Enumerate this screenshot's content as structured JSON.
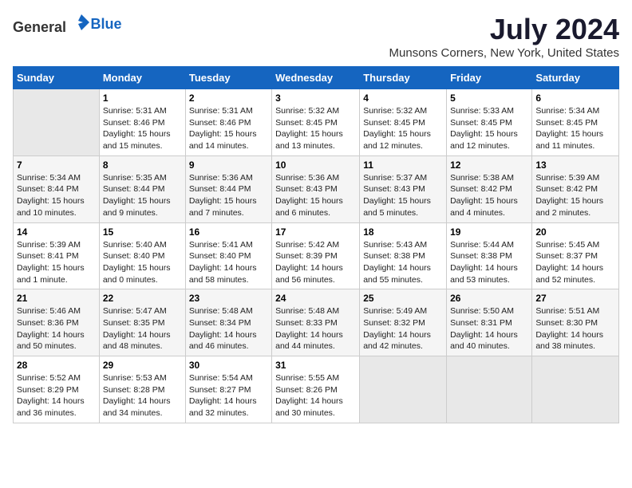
{
  "header": {
    "logo_general": "General",
    "logo_blue": "Blue",
    "title": "July 2024",
    "subtitle": "Munsons Corners, New York, United States"
  },
  "calendar": {
    "days_of_week": [
      "Sunday",
      "Monday",
      "Tuesday",
      "Wednesday",
      "Thursday",
      "Friday",
      "Saturday"
    ],
    "weeks": [
      [
        {
          "day": "",
          "info": ""
        },
        {
          "day": "1",
          "info": "Sunrise: 5:31 AM\nSunset: 8:46 PM\nDaylight: 15 hours\nand 15 minutes."
        },
        {
          "day": "2",
          "info": "Sunrise: 5:31 AM\nSunset: 8:46 PM\nDaylight: 15 hours\nand 14 minutes."
        },
        {
          "day": "3",
          "info": "Sunrise: 5:32 AM\nSunset: 8:45 PM\nDaylight: 15 hours\nand 13 minutes."
        },
        {
          "day": "4",
          "info": "Sunrise: 5:32 AM\nSunset: 8:45 PM\nDaylight: 15 hours\nand 12 minutes."
        },
        {
          "day": "5",
          "info": "Sunrise: 5:33 AM\nSunset: 8:45 PM\nDaylight: 15 hours\nand 12 minutes."
        },
        {
          "day": "6",
          "info": "Sunrise: 5:34 AM\nSunset: 8:45 PM\nDaylight: 15 hours\nand 11 minutes."
        }
      ],
      [
        {
          "day": "7",
          "info": "Sunrise: 5:34 AM\nSunset: 8:44 PM\nDaylight: 15 hours\nand 10 minutes."
        },
        {
          "day": "8",
          "info": "Sunrise: 5:35 AM\nSunset: 8:44 PM\nDaylight: 15 hours\nand 9 minutes."
        },
        {
          "day": "9",
          "info": "Sunrise: 5:36 AM\nSunset: 8:44 PM\nDaylight: 15 hours\nand 7 minutes."
        },
        {
          "day": "10",
          "info": "Sunrise: 5:36 AM\nSunset: 8:43 PM\nDaylight: 15 hours\nand 6 minutes."
        },
        {
          "day": "11",
          "info": "Sunrise: 5:37 AM\nSunset: 8:43 PM\nDaylight: 15 hours\nand 5 minutes."
        },
        {
          "day": "12",
          "info": "Sunrise: 5:38 AM\nSunset: 8:42 PM\nDaylight: 15 hours\nand 4 minutes."
        },
        {
          "day": "13",
          "info": "Sunrise: 5:39 AM\nSunset: 8:42 PM\nDaylight: 15 hours\nand 2 minutes."
        }
      ],
      [
        {
          "day": "14",
          "info": "Sunrise: 5:39 AM\nSunset: 8:41 PM\nDaylight: 15 hours\nand 1 minute."
        },
        {
          "day": "15",
          "info": "Sunrise: 5:40 AM\nSunset: 8:40 PM\nDaylight: 15 hours\nand 0 minutes."
        },
        {
          "day": "16",
          "info": "Sunrise: 5:41 AM\nSunset: 8:40 PM\nDaylight: 14 hours\nand 58 minutes."
        },
        {
          "day": "17",
          "info": "Sunrise: 5:42 AM\nSunset: 8:39 PM\nDaylight: 14 hours\nand 56 minutes."
        },
        {
          "day": "18",
          "info": "Sunrise: 5:43 AM\nSunset: 8:38 PM\nDaylight: 14 hours\nand 55 minutes."
        },
        {
          "day": "19",
          "info": "Sunrise: 5:44 AM\nSunset: 8:38 PM\nDaylight: 14 hours\nand 53 minutes."
        },
        {
          "day": "20",
          "info": "Sunrise: 5:45 AM\nSunset: 8:37 PM\nDaylight: 14 hours\nand 52 minutes."
        }
      ],
      [
        {
          "day": "21",
          "info": "Sunrise: 5:46 AM\nSunset: 8:36 PM\nDaylight: 14 hours\nand 50 minutes."
        },
        {
          "day": "22",
          "info": "Sunrise: 5:47 AM\nSunset: 8:35 PM\nDaylight: 14 hours\nand 48 minutes."
        },
        {
          "day": "23",
          "info": "Sunrise: 5:48 AM\nSunset: 8:34 PM\nDaylight: 14 hours\nand 46 minutes."
        },
        {
          "day": "24",
          "info": "Sunrise: 5:48 AM\nSunset: 8:33 PM\nDaylight: 14 hours\nand 44 minutes."
        },
        {
          "day": "25",
          "info": "Sunrise: 5:49 AM\nSunset: 8:32 PM\nDaylight: 14 hours\nand 42 minutes."
        },
        {
          "day": "26",
          "info": "Sunrise: 5:50 AM\nSunset: 8:31 PM\nDaylight: 14 hours\nand 40 minutes."
        },
        {
          "day": "27",
          "info": "Sunrise: 5:51 AM\nSunset: 8:30 PM\nDaylight: 14 hours\nand 38 minutes."
        }
      ],
      [
        {
          "day": "28",
          "info": "Sunrise: 5:52 AM\nSunset: 8:29 PM\nDaylight: 14 hours\nand 36 minutes."
        },
        {
          "day": "29",
          "info": "Sunrise: 5:53 AM\nSunset: 8:28 PM\nDaylight: 14 hours\nand 34 minutes."
        },
        {
          "day": "30",
          "info": "Sunrise: 5:54 AM\nSunset: 8:27 PM\nDaylight: 14 hours\nand 32 minutes."
        },
        {
          "day": "31",
          "info": "Sunrise: 5:55 AM\nSunset: 8:26 PM\nDaylight: 14 hours\nand 30 minutes."
        },
        {
          "day": "",
          "info": ""
        },
        {
          "day": "",
          "info": ""
        },
        {
          "day": "",
          "info": ""
        }
      ]
    ]
  }
}
